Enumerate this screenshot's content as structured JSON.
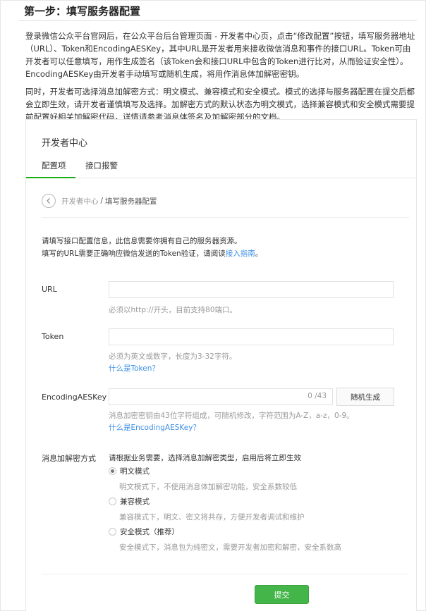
{
  "doc": {
    "title": "第一步：填写服务器配置",
    "paragraph1": "登录微信公众平台官网后，在公众平台后台管理页面 - 开发者中心页，点击“修改配置”按钮，填写服务器地址（URL）、Token和EncodingAESKey，其中URL是开发者用来接收微信消息和事件的接口URL。Token可由开发者可以任意填写，用作生成签名（该Token会和接口URL中包含的Token进行比对，从而验证安全性）。EncodingAESKey由开发者手动填写或随机生成，将用作消息体加解密密钥。",
    "paragraph2": "同时，开发者可选择消息加解密方式：明文模式、兼容模式和安全模式。模式的选择与服务器配置在提交后都会立即生效，请开发者谨慎填写及选择。加解密方式的默认状态为明文模式，选择兼容模式和安全模式需要提前配置好相关加解密代码，详情请参考消息体签名及加解密部分的文档。"
  },
  "console": {
    "title": "开发者中心",
    "tabs": [
      {
        "label": "配置项",
        "active": true
      },
      {
        "label": "接口报警",
        "active": false
      }
    ],
    "breadcrumb": {
      "root": "开发者中心",
      "separator": "/",
      "current": "填写服务器配置"
    },
    "intro_line1": "请填写接口配置信息，此信息需要你拥有自己的服务器资源。",
    "intro_line2_prefix": "填写的URL需要正确响应微信发送的Token验证，请阅读",
    "intro_line2_link": "接入指南",
    "intro_line2_suffix": "。",
    "url": {
      "label": "URL",
      "value": "",
      "hint": "必须以http://开头，目前支持80端口。"
    },
    "token": {
      "label": "Token",
      "value": "",
      "hint": "必须为英文或数字，长度为3-32字符。",
      "help_link": "什么是Token？"
    },
    "aes": {
      "label": "EncodingAESKey",
      "value": "",
      "counter": "0 /43",
      "generate_button": "随机生成",
      "hint": "消息加密密钥由43位字符组成，可随机修改，字符范围为A-Z，a-z，0-9。",
      "help_link": "什么是EncodingAESKey？"
    },
    "encryption": {
      "label": "消息加解密方式",
      "description": "请根据业务需要，选择消息加解密类型，启用后将立即生效",
      "options": [
        {
          "label": "明文模式",
          "desc": "明文模式下，不使用消息体加解密功能，安全系数较低",
          "checked": true
        },
        {
          "label": "兼容模式",
          "desc": "兼容模式下，明文、密文将共存，方便开发者调试和维护",
          "checked": false
        },
        {
          "label": "安全模式（推荐）",
          "desc": "安全模式下，消息包为纯密文，需要开发者加密和解密，安全系数高",
          "checked": false
        }
      ]
    },
    "submit_label": "提交"
  },
  "colors": {
    "accent_green": "#44b549",
    "link_blue": "#3a8ee6"
  }
}
